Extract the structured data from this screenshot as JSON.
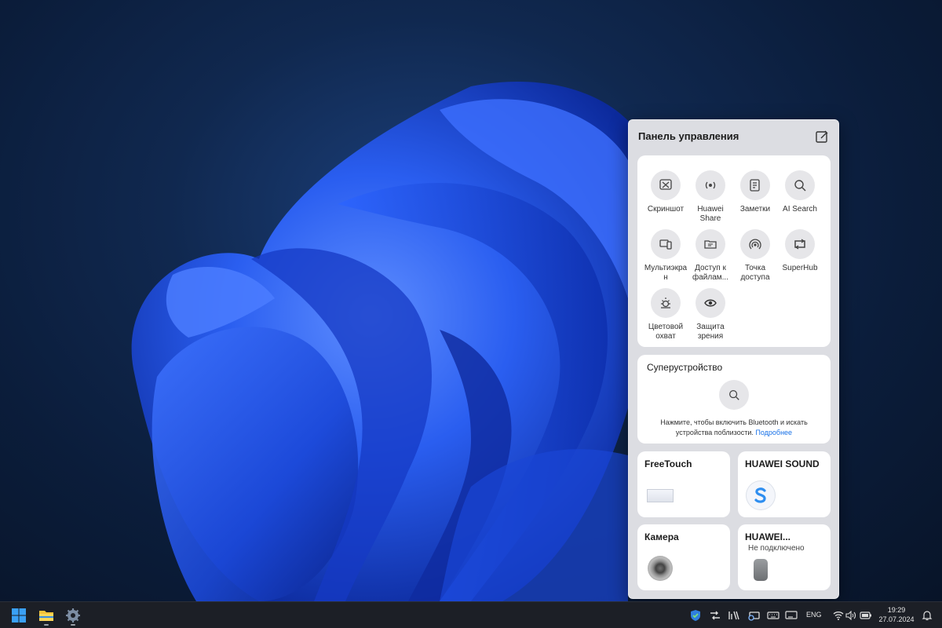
{
  "panel": {
    "title": "Панель управления",
    "edit_icon": "edit-icon"
  },
  "quick_tiles": [
    {
      "label": "Скриншот",
      "icon": "screenshot-icon"
    },
    {
      "label": "Huawei Share",
      "icon": "huawei-share-icon"
    },
    {
      "label": "Заметки",
      "icon": "notes-icon"
    },
    {
      "label": "AI Search",
      "icon": "search-icon"
    },
    {
      "label": "Мультиэкран",
      "icon": "multiscreen-icon"
    },
    {
      "label": "Доступ к файлам...",
      "icon": "file-access-icon"
    },
    {
      "label": "Точка доступа",
      "icon": "hotspot-icon"
    },
    {
      "label": "SuperHub",
      "icon": "superhub-icon"
    },
    {
      "label": "Цветовой охват",
      "icon": "color-gamut-icon"
    },
    {
      "label": "Защита зрения",
      "icon": "eye-icon"
    }
  ],
  "superdevice": {
    "title": "Суперустройство",
    "hint": "Нажмите, чтобы включить Bluetooth и искать устройства поблизости.",
    "link": "Подробнее"
  },
  "devices": {
    "freetouch": {
      "title": "FreeTouch"
    },
    "sound": {
      "title": "HUAWEI SOUND"
    },
    "camera": {
      "title": "Камера"
    },
    "huawei": {
      "title": "HUAWEI...",
      "status": "Не подключено"
    }
  },
  "taskbar": {
    "apps": [
      "windows-start-icon",
      "file-explorer-icon",
      "settings-icon"
    ],
    "lang": "ENG",
    "time": "19:29",
    "date": "27.07.2024"
  },
  "colors": {
    "accent_link": "#1a73e8",
    "panel_bg": "#dcdde2",
    "taskbar_bg": "#1c1f26",
    "wallpaper_blue": "#1f52e6"
  }
}
